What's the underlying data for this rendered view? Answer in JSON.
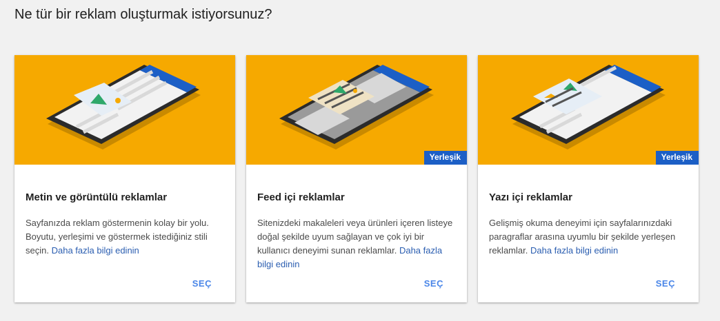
{
  "page": {
    "title": "Ne tür bir reklam oluşturmak istiyorsunuz?"
  },
  "cards": [
    {
      "title": "Metin ve görüntülü reklamlar",
      "description": "Sayfanızda reklam göstermenin kolay bir yolu. Boyutu, yerleşimi ve göstermek istediğiniz stili seçin.",
      "link": "Daha fazla bilgi edinin",
      "button": "SEÇ",
      "illustration": "phone-display-ad-icon"
    },
    {
      "badge": "Yerleşik",
      "title": "Feed içi reklamlar",
      "description": "Sitenizdeki makaleleri veya ürünleri içeren listeye doğal şekilde uyum sağlayan ve çok iyi bir kullanıcı deneyimi sunan reklamlar.",
      "link": "Daha fazla bilgi edinin",
      "button": "SEÇ",
      "illustration": "phone-feed-ad-icon"
    },
    {
      "badge": "Yerleşik",
      "title": "Yazı içi reklamlar",
      "description": "Gelişmiş okuma deneyimi için sayfalarınızdaki paragraflar arasına uyumlu bir şekilde yerleşen reklamlar.",
      "link": "Daha fazla bilgi edinin",
      "button": "SEÇ",
      "illustration": "phone-in-article-ad-icon"
    }
  ],
  "colors": {
    "hero": "#f6a900",
    "badge": "#1c5fc6",
    "link": "#2a5db0",
    "button": "#4a86e8"
  }
}
